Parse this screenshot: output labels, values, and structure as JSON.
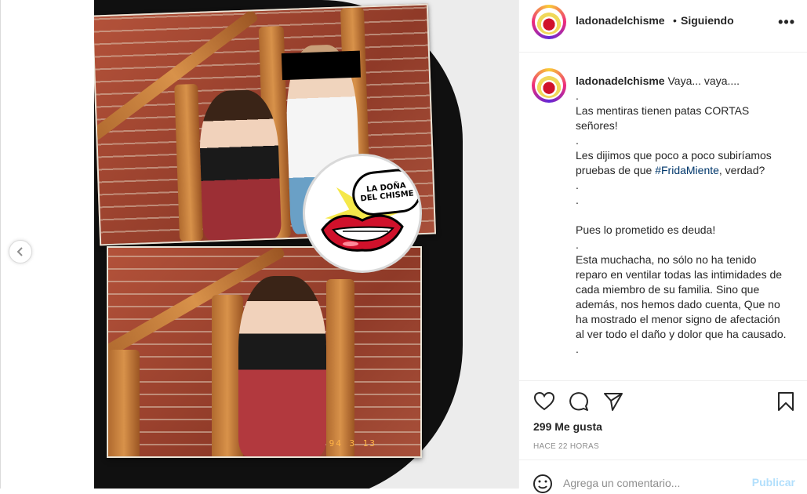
{
  "post": {
    "username": "ladonadelchisme",
    "separator": "•",
    "follow_status": "Siguiendo",
    "more_label": "•••"
  },
  "media": {
    "date_stamp": "94 3 13",
    "logo_line1": "LA DOÑA",
    "logo_line2": "DEL CHISME"
  },
  "caption": {
    "username": "ladonadelchisme",
    "lines": [
      " Vaya... vaya....",
      ".",
      "Las mentiras tienen patas CORTAS señores!",
      ".",
      "Les dijimos que poco a poco subiríamos pruebas de que",
      "#FridaMiente",
      ", verdad?",
      ".",
      ".",
      "Pues lo prometido es deuda!",
      ".",
      "Esta muchacha, no sólo no ha tenido reparo en ventilar todas las intimidades de cada miembro de su familia. Sino que además, nos hemos dado cuenta, Que no ha mostrado el menor signo de afectación al ver todo el daño y dolor que ha causado.",
      "."
    ]
  },
  "stats": {
    "likes": "299 Me gusta",
    "time": "HACE 22 HORAS"
  },
  "comment": {
    "placeholder": "Agrega un comentario...",
    "post_label": "Publicar"
  },
  "icons": {
    "prev": "chevron-left-icon",
    "like": "heart-icon",
    "comment": "comment-icon",
    "share": "paper-plane-icon",
    "save": "bookmark-icon",
    "emoji": "smiley-icon"
  },
  "colors": {
    "link": "#00376b",
    "muted": "#8e8e8e",
    "post_disabled": "#b2dffc",
    "border": "#efefef"
  }
}
